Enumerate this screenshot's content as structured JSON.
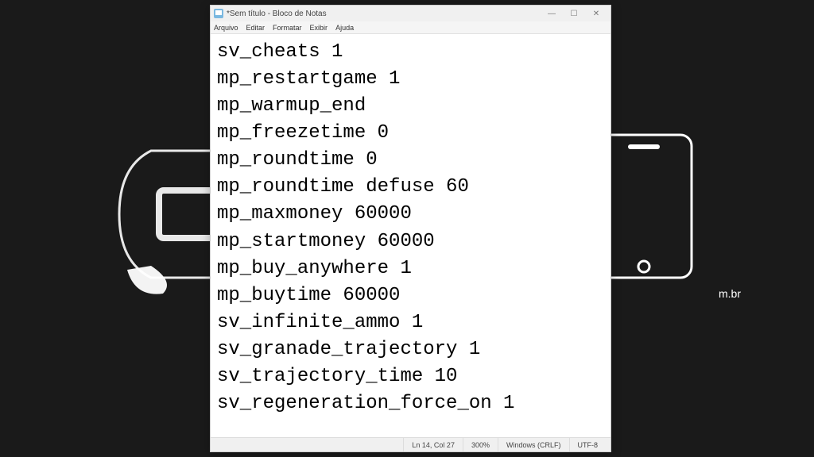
{
  "window": {
    "title": "*Sem título - Bloco de Notas"
  },
  "menu": {
    "file": "Arquivo",
    "edit": "Editar",
    "format": "Formatar",
    "view": "Exibir",
    "help": "Ajuda"
  },
  "document": {
    "content": "sv_cheats 1\nmp_restartgame 1\nmp_warmup_end\nmp_freezetime 0\nmp_roundtime 0\nmp_roundtime defuse 60\nmp_maxmoney 60000\nmp_startmoney 60000\nmp_buy_anywhere 1\nmp_buytime 60000\nsv_infinite_ammo 1\nsv_granade_trajectory 1\nsv_trajectory_time 10\nsv_regeneration_force_on 1"
  },
  "status": {
    "position": "Ln 14, Col 27",
    "zoom": "300%",
    "line_ending": "Windows (CRLF)",
    "encoding": "UTF-8"
  },
  "background": {
    "side_text": "m.br"
  },
  "win_controls": {
    "minimize": "—",
    "maximize": "☐",
    "close": "✕"
  }
}
